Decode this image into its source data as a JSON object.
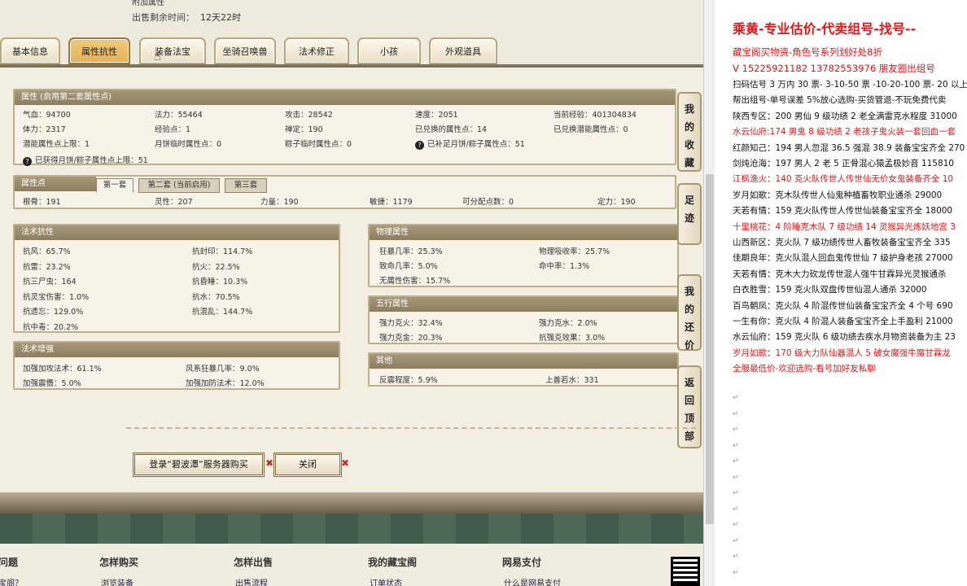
{
  "top": {
    "line1": "附加属性",
    "remain_label": "出售剩余时间：",
    "remain_value": "12天22时"
  },
  "tabs": [
    "基本信息",
    "属性抗性",
    "装备法宝",
    "坐骑召唤兽",
    "法术修正",
    "小孩",
    "外观道具"
  ],
  "active_tab": "属性抗性",
  "attr_title": "属性 (启用第二套属性点)",
  "attr_rows": [
    [
      [
        "气血：",
        "94700"
      ],
      [
        "法力：",
        "55464"
      ],
      [
        "攻击：",
        "28542"
      ],
      [
        "速度：",
        "2051"
      ],
      [
        "当前经验：",
        "401304834"
      ]
    ],
    [
      [
        "体力：",
        "2317"
      ],
      [
        "经验点：",
        "1"
      ],
      [
        "禅定：",
        "190"
      ],
      [
        "已兑换的属性点：",
        "14"
      ],
      [
        "已兑换潜能属性点：",
        "0"
      ]
    ],
    [
      [
        "潜能属性点上限：",
        "1"
      ],
      [
        "月饼临时属性点：",
        "0"
      ],
      [
        "粽子临时属性点：",
        "0"
      ],
      [
        "已补足月饼/粽子属性点：",
        "51"
      ]
    ]
  ],
  "attr_extra": "已获得月饼/粽子属性点上限：51",
  "points": {
    "title": "属性点",
    "subtabs": [
      "第一套",
      "第二套 (当前启用)",
      "第三套"
    ],
    "items": [
      [
        "根骨：",
        "191"
      ],
      [
        "灵性：",
        "207"
      ],
      [
        "力量：",
        "190"
      ],
      [
        "敏捷：",
        "1179"
      ],
      [
        "可分配点数：",
        "0"
      ],
      [
        "定力：",
        "190"
      ]
    ]
  },
  "resist": {
    "title": "法术抗性",
    "items": [
      [
        "抗风：",
        "65.7%"
      ],
      [
        "抗封印：",
        "114.7%"
      ],
      [
        "抗雷：",
        "23.2%"
      ],
      [
        "抗火：",
        "22.5%"
      ],
      [
        "抗三尸虫：",
        "164"
      ],
      [
        "抗昏睡：",
        "10.3%"
      ],
      [
        "抗灵宝伤害：",
        "1.0%"
      ],
      [
        "抗水：",
        "70.5%"
      ],
      [
        "抗遗忘：",
        "129.0%"
      ],
      [
        "抗混乱：",
        "144.7%"
      ],
      [
        "抗中毒：",
        "20.2%"
      ]
    ]
  },
  "enhance": {
    "title": "法术增强",
    "items": [
      [
        "加强加攻法术：",
        "61.1%"
      ],
      [
        "风系狂暴几率：",
        "9.0%"
      ],
      [
        "加强震慑：",
        "5.0%"
      ],
      [
        "加强加防法术：",
        "12.0%"
      ]
    ]
  },
  "phys": {
    "title": "物理属性",
    "items": [
      [
        "狂暴几率：",
        "25.3%"
      ],
      [
        "物理吸收率：",
        "25.7%"
      ],
      [
        "致命几率：",
        "5.0%"
      ],
      [
        "命中率：",
        "1.3%"
      ],
      [
        "无属性伤害：",
        "15.7%"
      ]
    ]
  },
  "five": {
    "title": "五行属性",
    "items": [
      [
        "强力克火：",
        "32.4%"
      ],
      [
        "强力克水：",
        "2.0%"
      ],
      [
        "强力克金：",
        "20.3%"
      ],
      [
        "抗强克效果：",
        "3.0%"
      ]
    ]
  },
  "other": {
    "title": "其他",
    "items": [
      [
        "反震程度：",
        "5.9%"
      ],
      [
        "上善若水：",
        "331"
      ]
    ]
  },
  "side_buttons": [
    "我的收藏",
    "足迹",
    "我的还价",
    "返回顶部"
  ],
  "buy_button": "登录“碧波潭”服务器购买",
  "close_button": "关闭",
  "footer": {
    "cols": [
      "问题",
      "怎样购买",
      "怎样出售",
      "我的藏宝阁",
      "网易支付"
    ],
    "links": [
      "宝阁？",
      "浏览装备",
      "出售流程",
      "订单状态",
      "什么是网易支付"
    ]
  },
  "doc": {
    "title": "乘黄-专业估价-代卖组号-找号--",
    "lines": [
      {
        "text": "藏宝阁买物资-角色号系列划好处8折",
        "red": true
      },
      {
        "text": "V 15225921182 13782553976 朋友圈出组号",
        "red": true
      },
      {
        "text": "扫码估号 3 万内 30 票- 3-10-50 票 -10-20-100 票- 20 以上",
        "red": false
      },
      {
        "text": "帮出组号-单号误差 5%放心选购-买货管退-不玩免费代卖",
        "red": false
      },
      {
        "text": "陕西专区：200 男仙 9 级功绩 2 老全满雷克水程度 31000",
        "red": false
      },
      {
        "text": "水云仙府:174 男鬼 8 级功绩 2 老孩子鬼火装一套回血一套",
        "red": true
      },
      {
        "text": "红颜知己：194 男人忽混 36.5 强混 38.9 装备宝宝齐全 270",
        "red": false
      },
      {
        "text": "剑炖沧海：197 男人 2 老 5 正骨混心猿孟极妙音 115810",
        "red": false
      },
      {
        "text": "江枫渔火：140 克火队传世人传世仙无价女鬼装备齐全 10",
        "red": true
      },
      {
        "text": "岁月如歌：克木队传世人仙鬼种植畜牧职业通杀 29000",
        "red": false
      },
      {
        "text": "天若有情：159 克火队传世人传世仙装备宝宝齐全 18000",
        "red": false
      },
      {
        "text": "十里桃花：4 阶睡克木队 7 级功绩 14 灵猴异光炼妖地宫 3",
        "red": true
      },
      {
        "text": "山西新区：克火队 7 级功绩传世人畜牧装备宝宝齐全 335",
        "red": false
      },
      {
        "text": "佳期良年：克火队混人回血鬼传世仙 7 级护身老孩 27000",
        "red": false
      },
      {
        "text": "天若有情：克木大力砍龙传世混人强牛甘霖异光灵猴通杀",
        "red": false
      },
      {
        "text": "白衣胜雪：159 克火队双盘传世仙混人通杀 32000",
        "red": false
      },
      {
        "text": "百鸟朝凤：克火队 4 阶混传世仙装备宝宝齐全 4 个号 690",
        "red": false
      },
      {
        "text": "一生有你：克火队 4 阶混人装备宝宝齐全上手盈利 21000",
        "red": false
      },
      {
        "text": "水云仙府：159 克火队 6 级功绩去疾水月物资装备为主 23",
        "red": false
      },
      {
        "text": "岁月如歌：170 级大力队仙器混人 5 破女魔强牛魔甘霖龙",
        "red": true
      },
      {
        "text": "全服最低价-欢迎选购-看号加好友私聊",
        "red": true
      }
    ],
    "para_mark": "↵"
  }
}
